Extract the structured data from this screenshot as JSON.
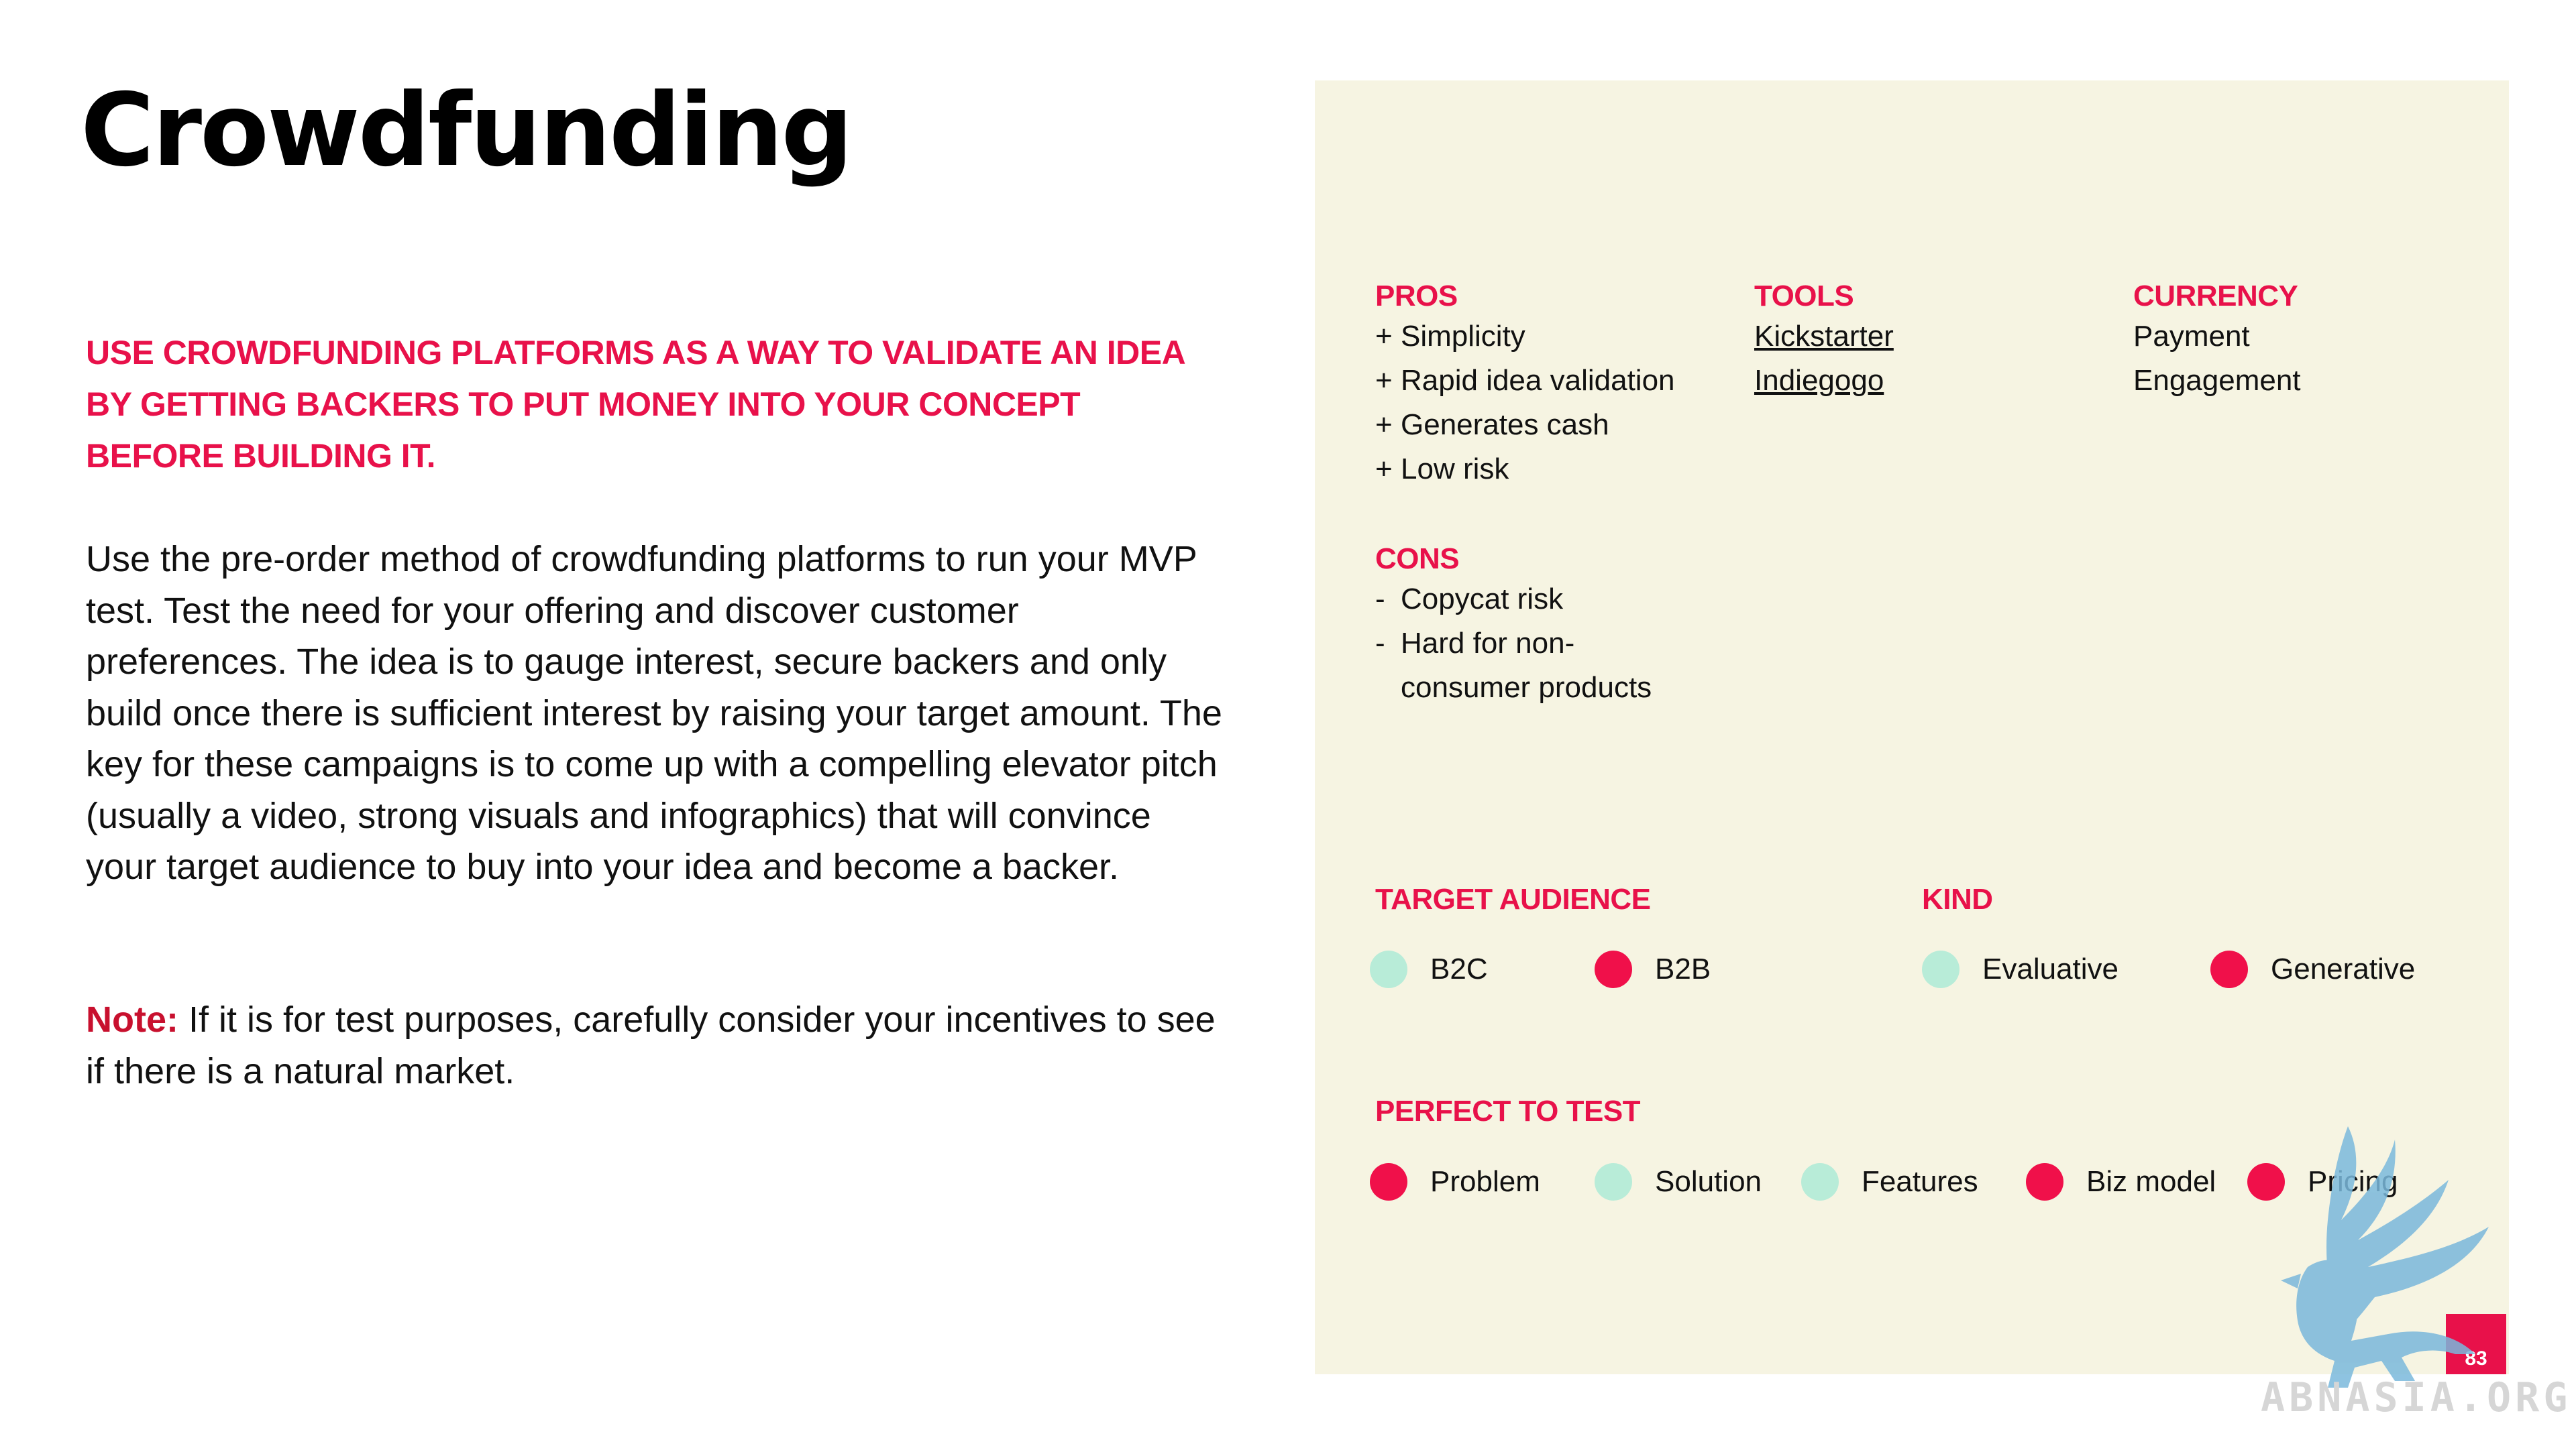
{
  "title": "Crowdfunding",
  "headline": "USE CROWDFUNDING PLATFORMS AS A WAY TO VALIDATE AN IDEA BY GETTING BACKERS TO PUT MONEY INTO YOUR CONCEPT BEFORE BUILDING IT.",
  "body": "Use the pre-order method of crowdfunding platforms to run your MVP test. Test the need for your offering and discover customer preferences. The idea is to gauge interest, secure backers and only build once there is sufficient interest by raising your target amount. The key for these campaigns is to come up with a compelling elevator pitch (usually a video, strong visuals and infographics) that will convince your target audience to buy into your idea and become a backer.",
  "note": {
    "label": "Note:",
    "text": "If it is for test purposes, carefully consider your incentives to see if there is a natural market."
  },
  "pros": {
    "label": "PROS",
    "marker": "+",
    "items": [
      "Simplicity",
      "Rapid idea validation",
      "Generates cash",
      "Low risk"
    ]
  },
  "cons": {
    "label": "CONS",
    "marker": "-",
    "items": [
      {
        "line1": "Copycat risk"
      },
      {
        "line1": "Hard for non-",
        "line2": "consumer products"
      }
    ]
  },
  "tools": {
    "label": "TOOLS",
    "items": [
      "Kickstarter",
      "Indiegogo"
    ]
  },
  "currency": {
    "label": "CURRENCY",
    "items": [
      "Payment",
      "Engagement"
    ]
  },
  "target_audience": {
    "label": "TARGET AUDIENCE",
    "options": [
      {
        "label": "B2C",
        "selected": false
      },
      {
        "label": "B2B",
        "selected": true
      }
    ]
  },
  "kind": {
    "label": "KIND",
    "options": [
      {
        "label": "Evaluative",
        "selected": false
      },
      {
        "label": "Generative",
        "selected": true
      }
    ]
  },
  "perfect_to_test": {
    "label": "PERFECT TO TEST",
    "options": [
      {
        "label": "Problem",
        "selected": true
      },
      {
        "label": "Solution",
        "selected": false
      },
      {
        "label": "Features",
        "selected": false
      },
      {
        "label": "Biz model",
        "selected": true
      },
      {
        "label": "Pricing",
        "selected": true
      }
    ]
  },
  "page_number": "83",
  "watermark": "ABNASIA.ORG",
  "colors": {
    "accent": "#e8114a",
    "panel": "#f6f4e2",
    "dot_on": "#f0104a",
    "dot_off": "#b8ecd8"
  }
}
